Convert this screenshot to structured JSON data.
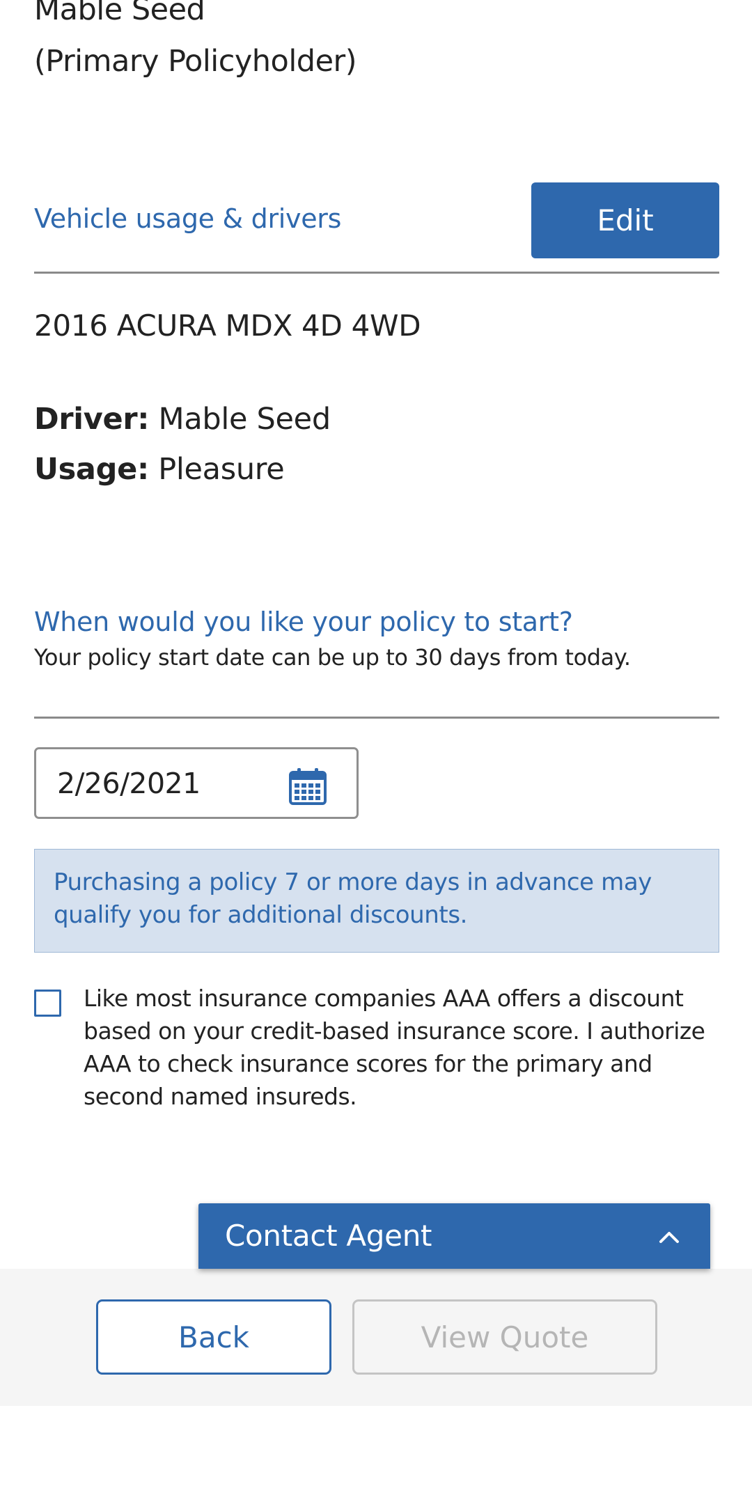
{
  "policyholder": {
    "name": "Mable Seed",
    "role": "(Primary Policyholder)"
  },
  "vehicle_section": {
    "title": "Vehicle usage & drivers",
    "edit_label": "Edit",
    "vehicle_name": "2016 ACURA MDX 4D 4WD",
    "driver_label": "Driver:",
    "driver_value": "Mable Seed",
    "usage_label": "Usage:",
    "usage_value": "Pleasure"
  },
  "start_date": {
    "question": "When would you like your policy to start?",
    "helper": "Your policy start date can be up to 30 days from today.",
    "value": "2/26/2021",
    "icon": "calendar-icon"
  },
  "info_notice": "Purchasing a policy 7 or more days in advance may qualify you for additional discounts.",
  "consent": {
    "checked": false,
    "text": "Like most insurance companies AAA offers a discount based on your credit-based insurance score. I authorize AAA to check insurance scores for the primary and second named insureds."
  },
  "contact_agent": {
    "label": "Contact Agent",
    "icon": "chevron-up-icon"
  },
  "footer": {
    "back_label": "Back",
    "view_quote_label": "View Quote"
  },
  "colors": {
    "brand_blue": "#2e68ad",
    "info_bg": "#d6e1ef",
    "disabled_gray": "#b5b5b5"
  }
}
